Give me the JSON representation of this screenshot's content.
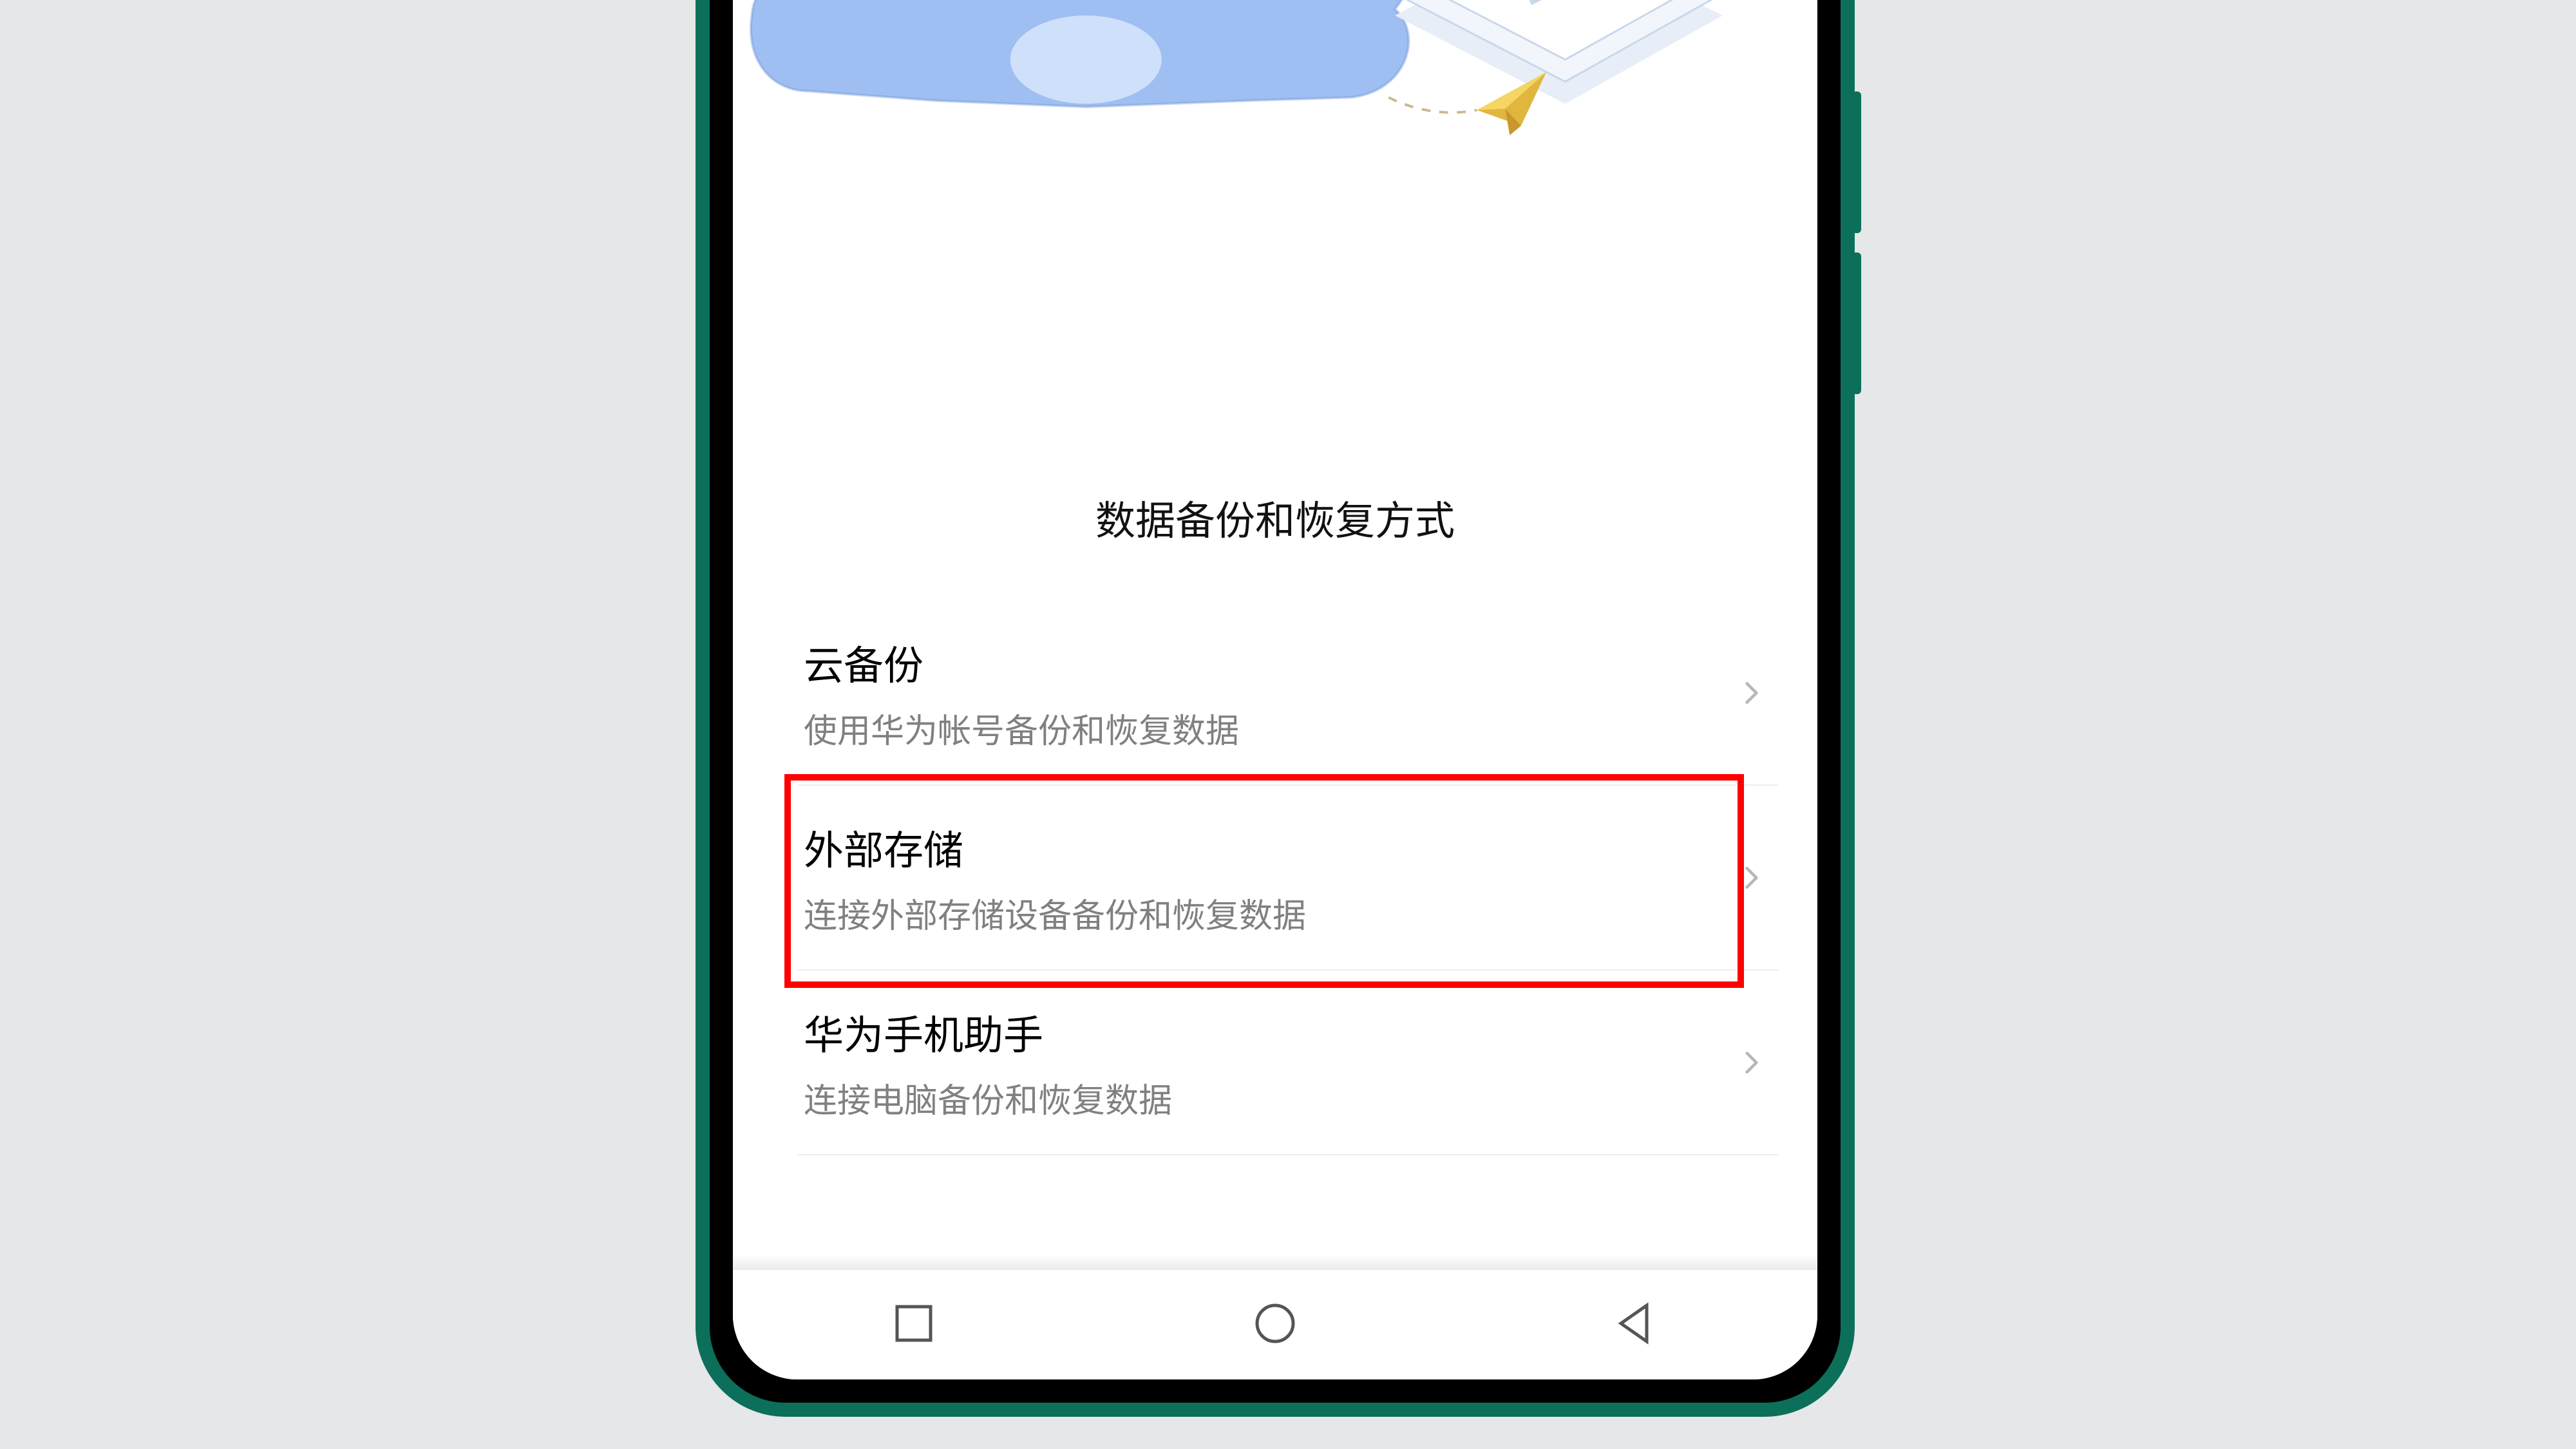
{
  "section_title": "数据备份和恢复方式",
  "rows": [
    {
      "title": "云备份",
      "desc": "使用华为帐号备份和恢复数据"
    },
    {
      "title": "外部存储",
      "desc": "连接外部存储设备备份和恢复数据"
    },
    {
      "title": "华为手机助手",
      "desc": "连接电脑备份和恢复数据"
    }
  ],
  "highlighted_row_index": 1
}
